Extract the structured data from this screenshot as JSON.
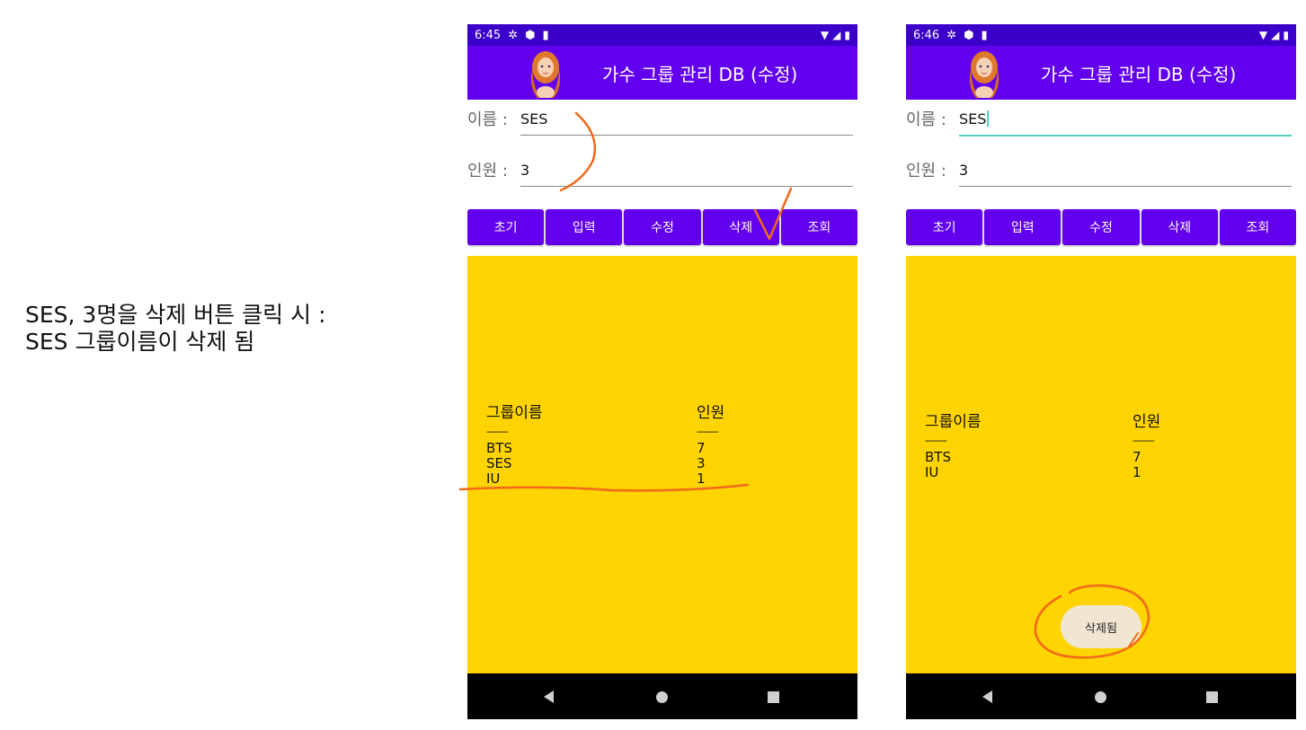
{
  "caption": {
    "line1": "SES, 3명을 삭제 버튼 클릭 시 :",
    "line2": "SES 그룹이름이 삭제 됨"
  },
  "left": {
    "status": {
      "time": "6:45",
      "icons": [
        "gear-icon",
        "shield-icon",
        "sd-card-icon"
      ],
      "right_icons": [
        "wifi-icon",
        "signal-icon",
        "battery-icon"
      ]
    },
    "app_title": "가수 그룹 관리 DB (수정)",
    "name_label": "이름 :",
    "name_value": "SES",
    "count_label": "인원 :",
    "count_value": "3",
    "buttons": [
      "초기",
      "입력",
      "수정",
      "삭제",
      "조회"
    ],
    "table": {
      "col1_header": "그룹이름",
      "col2_header": "인원",
      "divider": "--------",
      "rows": [
        {
          "name": "BTS",
          "count": "7"
        },
        {
          "name": "SES",
          "count": "3"
        },
        {
          "name": "IU",
          "count": "1"
        }
      ]
    }
  },
  "right": {
    "status": {
      "time": "6:46",
      "icons": [
        "gear-icon",
        "shield-icon",
        "sd-card-icon"
      ],
      "right_icons": [
        "wifi-icon",
        "signal-icon",
        "battery-icon"
      ]
    },
    "app_title": "가수 그룹 관리 DB (수정)",
    "name_label": "이름 :",
    "name_value": "SES",
    "count_label": "인원 :",
    "count_value": "3",
    "buttons": [
      "초기",
      "입력",
      "수정",
      "삭제",
      "조회"
    ],
    "table": {
      "col1_header": "그룹이름",
      "col2_header": "인원",
      "divider": "--------",
      "rows": [
        {
          "name": "BTS",
          "count": "7"
        },
        {
          "name": "IU",
          "count": "1"
        }
      ]
    },
    "toast": "삭제됨"
  },
  "colors": {
    "status_bar": "#3a00c9",
    "app_bar": "#6200ee",
    "result_bg": "#ffd400",
    "annotation": "#f26a1b",
    "focus_line": "#4fd3c4"
  }
}
